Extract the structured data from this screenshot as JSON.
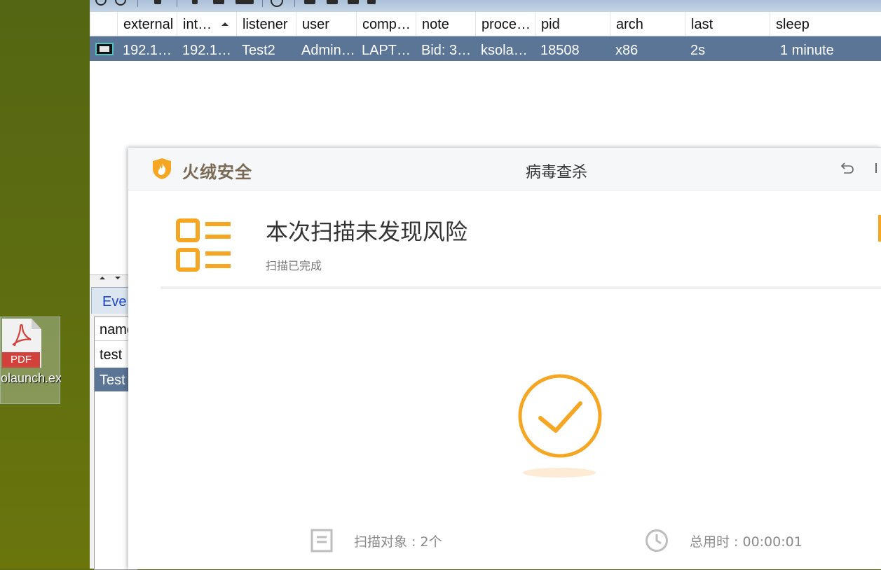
{
  "desktop": {
    "file_icon_badge": "PDF",
    "file_label": "olaunch.exe"
  },
  "c2": {
    "columns": [
      "external",
      "int…",
      "listener",
      "user",
      "comp…",
      "note",
      "proce…",
      "pid",
      "arch",
      "last",
      "sleep"
    ],
    "sorted_column": "int…",
    "rows": [
      {
        "external": "192.1…",
        "internal": "192.1…",
        "listener": "Test2",
        "user": "Admin…",
        "computer": "LAPT…",
        "note": "Bid: 3…",
        "process": "ksola…",
        "pid": "18508",
        "arch": "x86",
        "last": "2s",
        "sleep": "1 minute"
      }
    ],
    "lower_tab": "Eve",
    "lower_list": {
      "header": "name",
      "items": [
        "test",
        "Test"
      ]
    }
  },
  "av": {
    "brand": "火绒安全",
    "window_title": "病毒查杀",
    "headline": "本次扫描未发现风险",
    "subtext": "扫描已完成",
    "stat_objects": "扫描对象 : 2个",
    "stat_time": "总用时 : 00:00:01",
    "accent_color": "#f5a623"
  }
}
